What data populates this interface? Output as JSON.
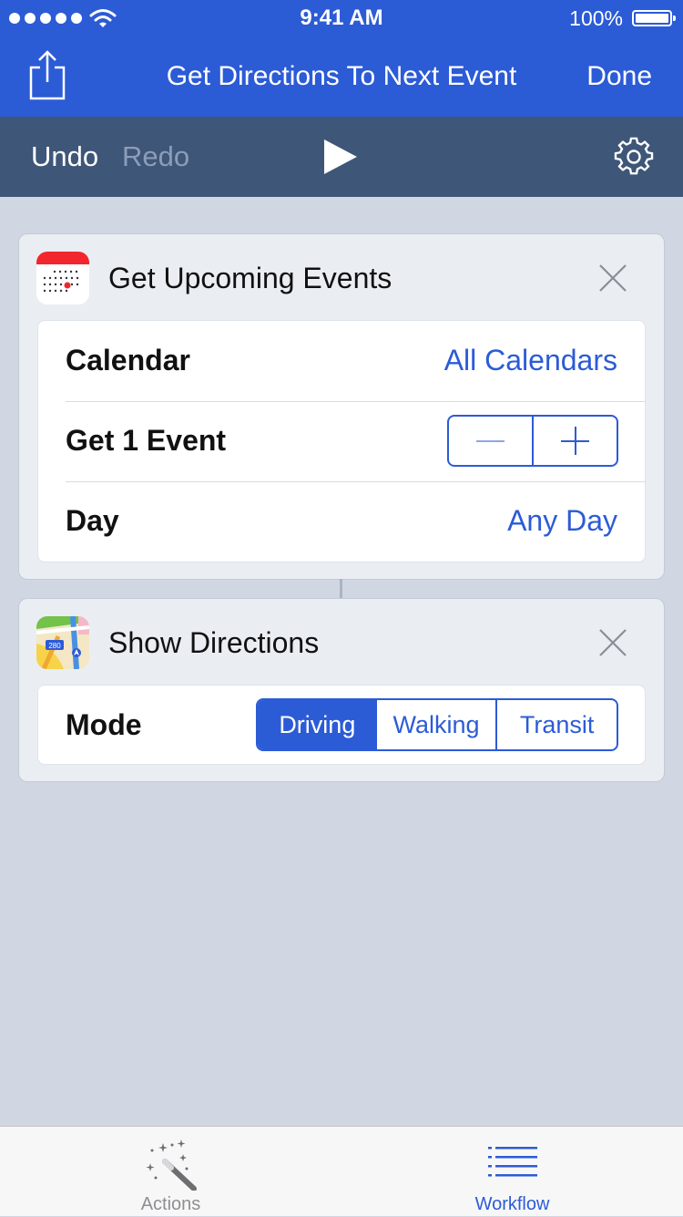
{
  "status_bar": {
    "time": "9:41 AM",
    "battery": "100%"
  },
  "nav": {
    "title": "Get Directions To Next Event",
    "done_label": "Done"
  },
  "toolbar": {
    "undo_label": "Undo",
    "redo_label": "Redo"
  },
  "actions": [
    {
      "title": "Get Upcoming Events",
      "icon": "calendar-app-icon",
      "rows": [
        {
          "label": "Calendar",
          "value": "All Calendars"
        },
        {
          "label": "Get 1 Event",
          "control": "stepper"
        },
        {
          "label": "Day",
          "value": "Any Day"
        }
      ]
    },
    {
      "title": "Show Directions",
      "icon": "maps-app-icon",
      "mode_label": "Mode",
      "mode_options": [
        "Driving",
        "Walking",
        "Transit"
      ],
      "mode_selected": "Driving"
    }
  ],
  "maps_icon_text": "280",
  "tabs": [
    {
      "label": "Actions",
      "icon": "magic-wand-icon",
      "active": false
    },
    {
      "label": "Workflow",
      "icon": "list-icon",
      "active": true
    }
  ],
  "colors": {
    "accent": "#2c5bd6",
    "toolbar": "#3e5678",
    "background": "#d0d7e2"
  }
}
